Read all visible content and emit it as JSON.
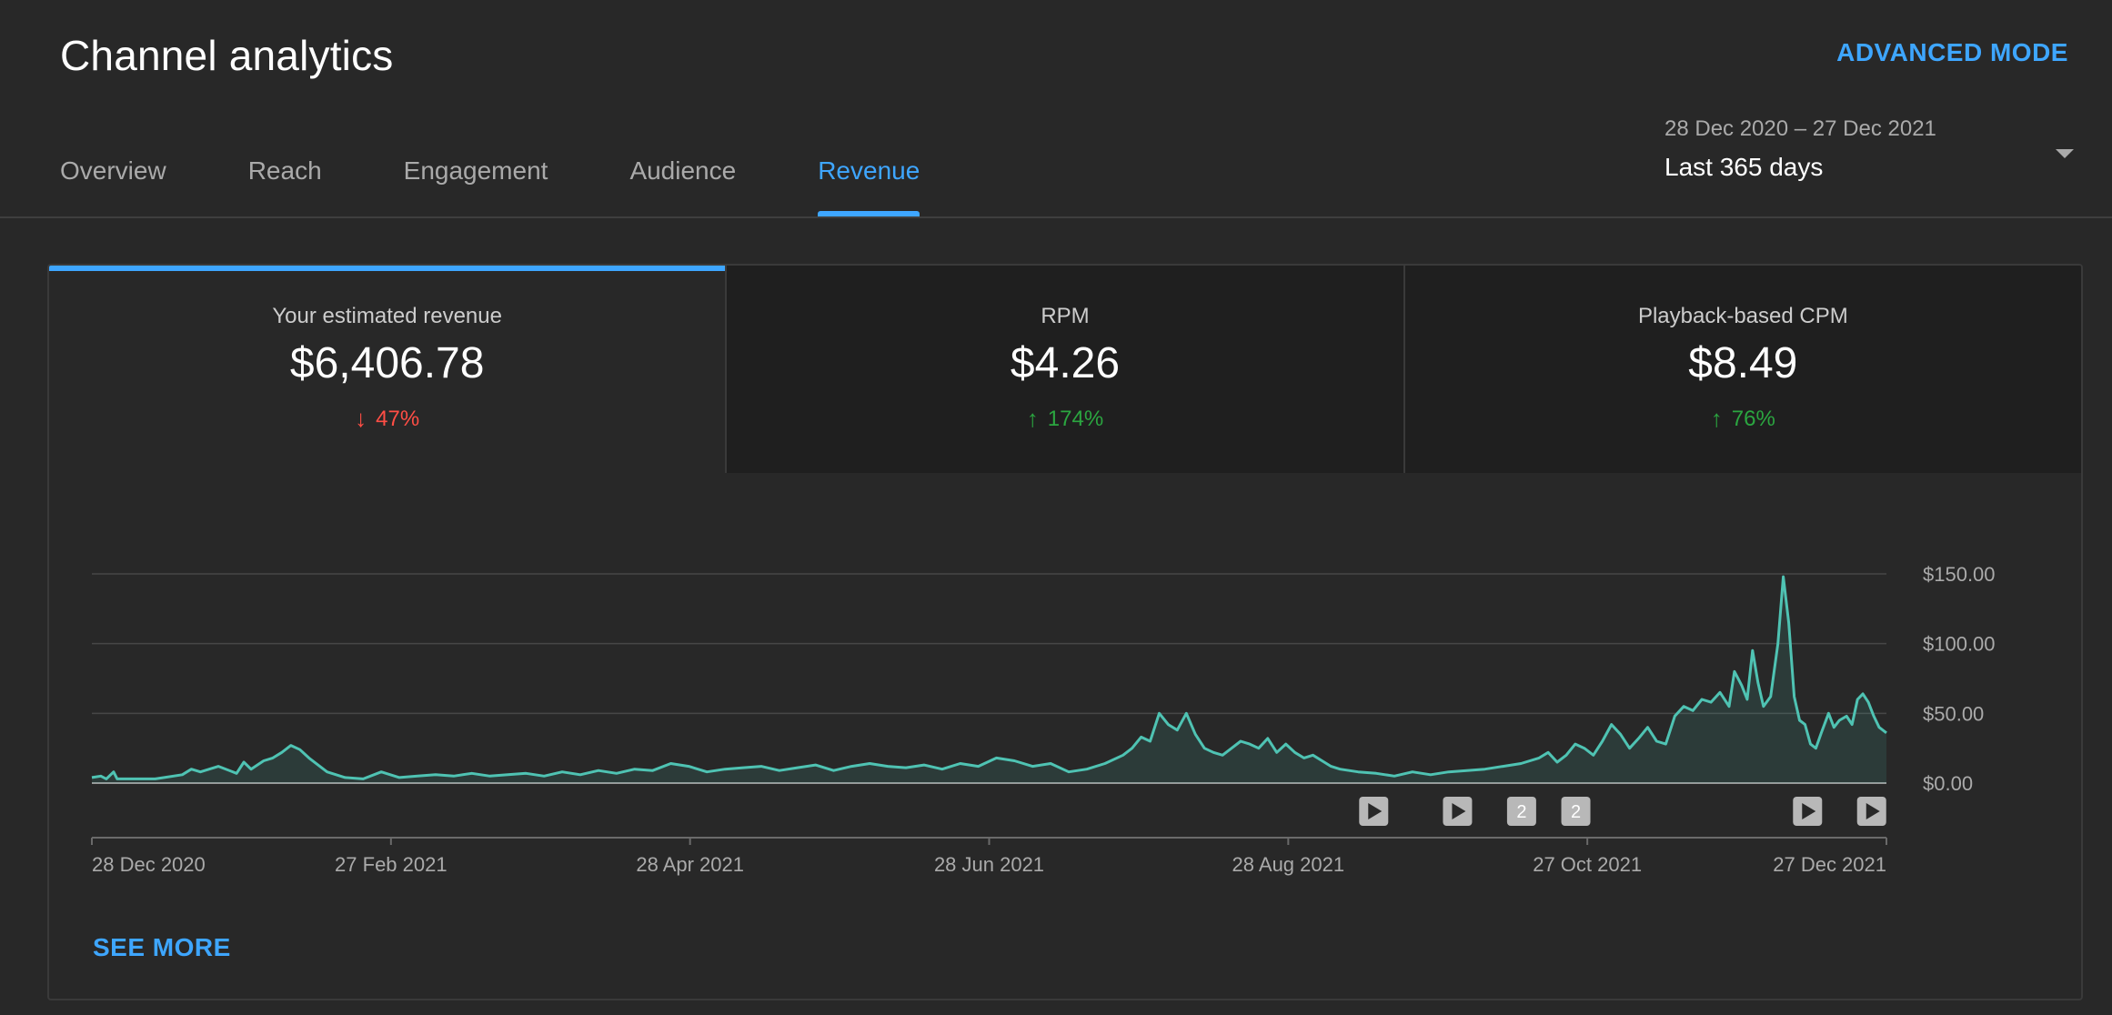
{
  "header": {
    "title": "Channel analytics",
    "advanced_mode": "ADVANCED MODE",
    "tabs": [
      {
        "label": "Overview",
        "active": false
      },
      {
        "label": "Reach",
        "active": false
      },
      {
        "label": "Engagement",
        "active": false
      },
      {
        "label": "Audience",
        "active": false
      },
      {
        "label": "Revenue",
        "active": true
      }
    ],
    "date_range": {
      "range": "28 Dec 2020 – 27 Dec 2021",
      "preset": "Last 365 days"
    }
  },
  "metrics": [
    {
      "label": "Your estimated revenue",
      "value": "$6,406.78",
      "delta": "47%",
      "direction": "down",
      "active": true
    },
    {
      "label": "RPM",
      "value": "$4.26",
      "delta": "174%",
      "direction": "up",
      "active": false
    },
    {
      "label": "Playback-based CPM",
      "value": "$8.49",
      "delta": "76%",
      "direction": "up",
      "active": false
    }
  ],
  "see_more": "SEE MORE",
  "colors": {
    "accent": "#3ea6ff",
    "line": "#4fc3b3",
    "down": "#ff4e45",
    "up": "#2ba640"
  },
  "chart_data": {
    "type": "area",
    "x_start": "28 Dec 2020",
    "x_end": "27 Dec 2021",
    "xticks": [
      "28 Dec 2020",
      "27 Feb 2021",
      "28 Apr 2021",
      "28 Jun 2021",
      "28 Aug 2021",
      "27 Oct 2021",
      "27 Dec 2021"
    ],
    "yticks": [
      "$0.00",
      "$50.00",
      "$100.00",
      "$150.00"
    ],
    "ylim": [
      0,
      150
    ],
    "grid": true,
    "events": [
      {
        "date": "14 Sep 2021",
        "type": "video"
      },
      {
        "date": "1 Oct 2021",
        "type": "video"
      },
      {
        "date": "14 Oct 2021",
        "type": "count",
        "label": "2"
      },
      {
        "date": "25 Oct 2021",
        "type": "count",
        "label": "2"
      },
      {
        "date": "11 Dec 2021",
        "type": "video"
      },
      {
        "date": "24 Dec 2021",
        "type": "video"
      }
    ],
    "series": [
      {
        "values": [
          [
            0,
            4
          ],
          [
            5,
            5
          ],
          [
            8,
            3
          ],
          [
            12,
            8
          ],
          [
            14,
            3
          ],
          [
            35,
            3
          ],
          [
            40,
            4
          ],
          [
            50,
            6
          ],
          [
            55,
            10
          ],
          [
            60,
            8
          ],
          [
            70,
            12
          ],
          [
            80,
            7
          ],
          [
            84,
            15
          ],
          [
            88,
            10
          ],
          [
            95,
            16
          ],
          [
            100,
            18
          ],
          [
            105,
            22
          ],
          [
            110,
            27
          ],
          [
            115,
            24
          ],
          [
            120,
            18
          ],
          [
            130,
            8
          ],
          [
            140,
            4
          ],
          [
            150,
            3
          ],
          [
            160,
            8
          ],
          [
            170,
            4
          ],
          [
            180,
            5
          ],
          [
            190,
            6
          ],
          [
            200,
            5
          ],
          [
            210,
            7
          ],
          [
            220,
            5
          ],
          [
            230,
            6
          ],
          [
            240,
            7
          ],
          [
            250,
            5
          ],
          [
            260,
            8
          ],
          [
            270,
            6
          ],
          [
            280,
            9
          ],
          [
            290,
            7
          ],
          [
            300,
            10
          ],
          [
            310,
            9
          ],
          [
            320,
            14
          ],
          [
            330,
            12
          ],
          [
            340,
            8
          ],
          [
            350,
            10
          ],
          [
            360,
            11
          ],
          [
            370,
            12
          ],
          [
            380,
            9
          ],
          [
            390,
            11
          ],
          [
            400,
            13
          ],
          [
            410,
            9
          ],
          [
            420,
            12
          ],
          [
            430,
            14
          ],
          [
            440,
            12
          ],
          [
            450,
            11
          ],
          [
            460,
            13
          ],
          [
            470,
            10
          ],
          [
            480,
            14
          ],
          [
            490,
            12
          ],
          [
            500,
            18
          ],
          [
            510,
            16
          ],
          [
            520,
            12
          ],
          [
            530,
            14
          ],
          [
            540,
            8
          ],
          [
            550,
            10
          ],
          [
            560,
            14
          ],
          [
            570,
            20
          ],
          [
            575,
            25
          ],
          [
            580,
            33
          ],
          [
            585,
            30
          ],
          [
            590,
            50
          ],
          [
            595,
            42
          ],
          [
            600,
            38
          ],
          [
            605,
            50
          ],
          [
            610,
            35
          ],
          [
            615,
            25
          ],
          [
            620,
            22
          ],
          [
            625,
            20
          ],
          [
            630,
            25
          ],
          [
            635,
            30
          ],
          [
            640,
            28
          ],
          [
            645,
            25
          ],
          [
            650,
            32
          ],
          [
            655,
            22
          ],
          [
            660,
            28
          ],
          [
            665,
            22
          ],
          [
            670,
            18
          ],
          [
            675,
            20
          ],
          [
            680,
            16
          ],
          [
            685,
            12
          ],
          [
            690,
            10
          ],
          [
            700,
            8
          ],
          [
            710,
            7
          ],
          [
            720,
            5
          ],
          [
            730,
            8
          ],
          [
            740,
            6
          ],
          [
            750,
            8
          ],
          [
            760,
            9
          ],
          [
            770,
            10
          ],
          [
            780,
            12
          ],
          [
            790,
            14
          ],
          [
            800,
            18
          ],
          [
            805,
            22
          ],
          [
            810,
            15
          ],
          [
            815,
            20
          ],
          [
            820,
            28
          ],
          [
            825,
            25
          ],
          [
            830,
            20
          ],
          [
            835,
            30
          ],
          [
            840,
            42
          ],
          [
            845,
            35
          ],
          [
            850,
            25
          ],
          [
            855,
            32
          ],
          [
            860,
            40
          ],
          [
            865,
            30
          ],
          [
            870,
            28
          ],
          [
            875,
            48
          ],
          [
            880,
            55
          ],
          [
            885,
            52
          ],
          [
            890,
            60
          ],
          [
            895,
            58
          ],
          [
            900,
            65
          ],
          [
            905,
            55
          ],
          [
            908,
            80
          ],
          [
            912,
            70
          ],
          [
            915,
            60
          ],
          [
            918,
            95
          ],
          [
            921,
            72
          ],
          [
            924,
            55
          ],
          [
            928,
            62
          ],
          [
            932,
            100
          ],
          [
            935,
            148
          ],
          [
            938,
            115
          ],
          [
            941,
            62
          ],
          [
            944,
            45
          ],
          [
            947,
            42
          ],
          [
            950,
            28
          ],
          [
            953,
            25
          ],
          [
            956,
            36
          ],
          [
            960,
            50
          ],
          [
            963,
            40
          ],
          [
            966,
            45
          ],
          [
            970,
            48
          ],
          [
            973,
            42
          ],
          [
            976,
            60
          ],
          [
            979,
            64
          ],
          [
            982,
            58
          ],
          [
            985,
            48
          ],
          [
            988,
            40
          ],
          [
            992,
            36
          ]
        ]
      }
    ]
  }
}
